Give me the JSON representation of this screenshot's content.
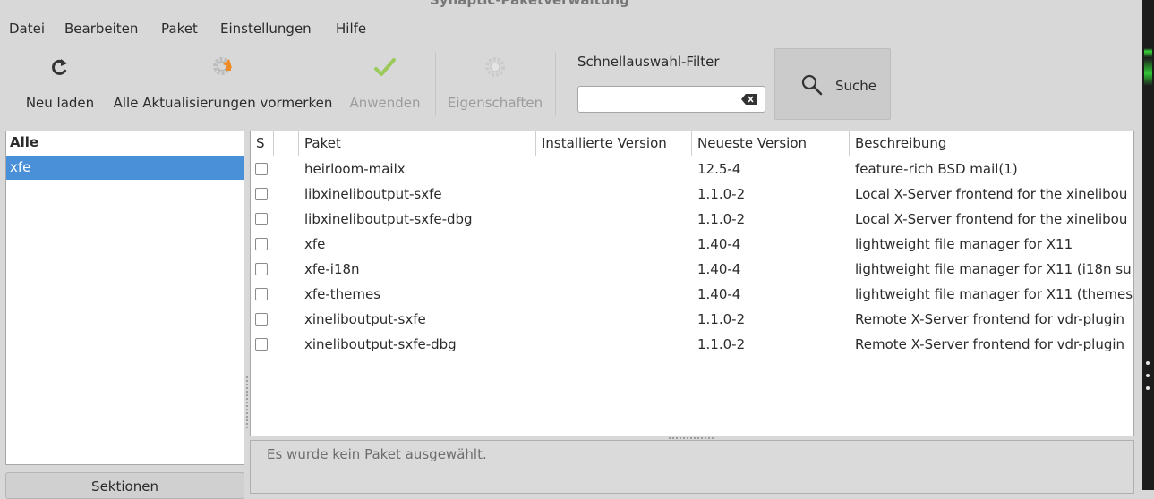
{
  "window": {
    "title": "Synaptic-Paketverwaltung"
  },
  "menubar": {
    "items": [
      "Datei",
      "Bearbeiten",
      "Paket",
      "Einstellungen",
      "Hilfe"
    ]
  },
  "toolbar": {
    "reload_label": "Neu laden",
    "mark_upgrades_label": "Alle Aktualisierungen vormerken",
    "apply_label": "Anwenden",
    "properties_label": "Eigenschaften",
    "filter_label": "Schnellauswahl-Filter",
    "filter_value": "",
    "search_label": "Suche"
  },
  "left_panel": {
    "header": "Alle",
    "items": [
      "xfe"
    ],
    "sections_button": "Sektionen"
  },
  "package_table": {
    "columns": [
      "S",
      "",
      "Paket",
      "Installierte Version",
      "Neueste Version",
      "Beschreibung"
    ],
    "rows": [
      {
        "name": "heirloom-mailx",
        "installed": "",
        "latest": "12.5-4",
        "description": "feature-rich BSD mail(1)"
      },
      {
        "name": "libxineliboutput-sxfe",
        "installed": "",
        "latest": "1.1.0-2",
        "description": "Local X-Server frontend for the xinelibou"
      },
      {
        "name": "libxineliboutput-sxfe-dbg",
        "installed": "",
        "latest": "1.1.0-2",
        "description": "Local X-Server frontend for the xinelibou"
      },
      {
        "name": "xfe",
        "installed": "",
        "latest": "1.40-4",
        "description": "lightweight file manager for X11"
      },
      {
        "name": "xfe-i18n",
        "installed": "",
        "latest": "1.40-4",
        "description": "lightweight file manager for X11 (i18n su"
      },
      {
        "name": "xfe-themes",
        "installed": "",
        "latest": "1.40-4",
        "description": "lightweight file manager for X11 (themes"
      },
      {
        "name": "xineliboutput-sxfe",
        "installed": "",
        "latest": "1.1.0-2",
        "description": "Remote X-Server frontend for vdr-plugin"
      },
      {
        "name": "xineliboutput-sxfe-dbg",
        "installed": "",
        "latest": "1.1.0-2",
        "description": "Remote X-Server frontend for vdr-plugin"
      }
    ]
  },
  "description_panel": {
    "text": "Es wurde kein Paket ausgewählt."
  },
  "colors": {
    "selection": "#4a90d9",
    "window_bg": "#d8d8d8",
    "apply_check": "#8fc24a",
    "gear": "#bdbdbd"
  }
}
